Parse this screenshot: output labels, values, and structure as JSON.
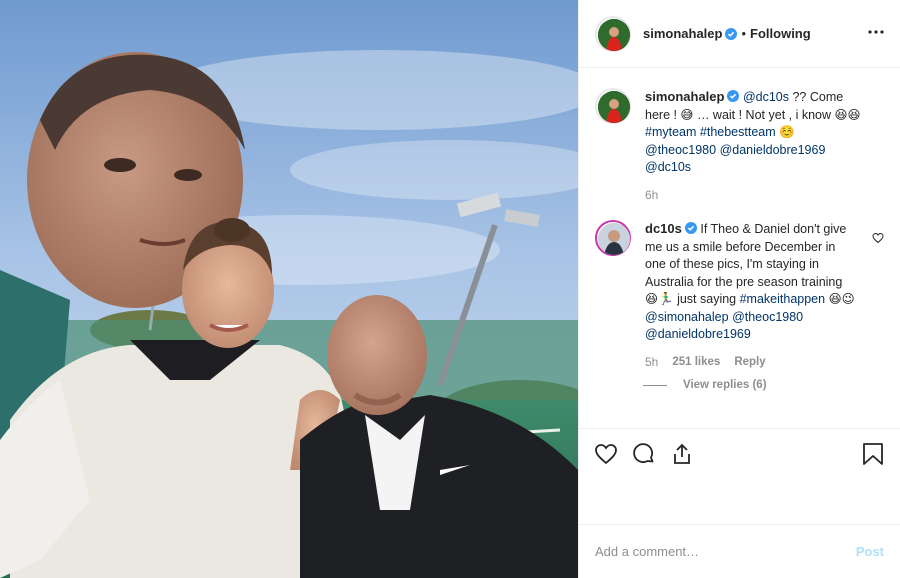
{
  "post": {
    "username": "simonahalep",
    "follow_status": "Following",
    "dot": "•"
  },
  "caption": {
    "username": "simonahalep",
    "mention": "@dc10s",
    "text_1": " ?? Come here ! 😅 … wait ! Not yet , i know 😆😆 ",
    "hashtag_1": "#myteam",
    "hashtag_2": "#thebestteam",
    "text_2": " ☺️ ",
    "mention_2": "@theoc1980",
    "mention_3": "@danieldobre1969",
    "mention_4": "@dc10s",
    "time": "6h"
  },
  "reply": {
    "username": "dc10s",
    "text_1": " If Theo & Daniel don't give me us a smile before December in one of these pics, I'm staying in Australia for the pre season training 😆🏃‍♂️ just saying ",
    "hashtag": "#makeithappen",
    "text_2": " 😆😉 ",
    "mention_1": "@simonahalep",
    "mention_2": "@theoc1980",
    "mention_3": "@danieldobre1969",
    "time": "5h",
    "likes": "251 likes",
    "reply_label": "Reply",
    "view_replies": "View replies (6)"
  },
  "add_comment": {
    "placeholder": "Add a comment…",
    "post_label": "Post"
  },
  "icons": {
    "like": "heart-icon",
    "comment": "comment-icon",
    "share": "share-icon",
    "save": "bookmark-icon",
    "more": "more-options-icon",
    "verified": "verified-badge-icon"
  },
  "colors": {
    "verified": "#3897f0",
    "link": "#003569",
    "muted": "#8e8e8e",
    "post_button": "#b2dffc"
  }
}
